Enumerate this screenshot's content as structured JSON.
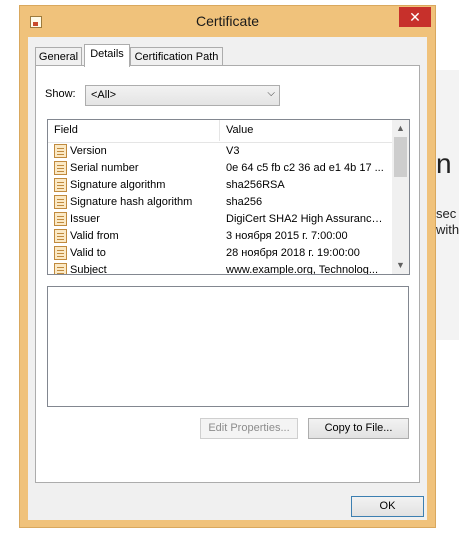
{
  "window": {
    "title": "Certificate",
    "close_glyph": "✕"
  },
  "tabs": [
    {
      "label": "General",
      "active": false
    },
    {
      "label": "Details",
      "active": true
    },
    {
      "label": "Certification Path",
      "active": false
    }
  ],
  "show": {
    "label": "Show:",
    "value": "<All>"
  },
  "fields_table": {
    "columns": [
      "Field",
      "Value"
    ],
    "rows": [
      {
        "field": "Version",
        "value": "V3"
      },
      {
        "field": "Serial number",
        "value": "0e 64 c5 fb c2 36 ad e1 4b 17 ..."
      },
      {
        "field": "Signature algorithm",
        "value": "sha256RSA"
      },
      {
        "field": "Signature hash algorithm",
        "value": "sha256"
      },
      {
        "field": "Issuer",
        "value": "DigiCert SHA2 High Assurance ..."
      },
      {
        "field": "Valid from",
        "value": "3 ноября 2015 г. 7:00:00"
      },
      {
        "field": "Valid to",
        "value": "28 ноября 2018 г. 19:00:00"
      },
      {
        "field": "Subject",
        "value": "www.example.org, Technolog..."
      }
    ]
  },
  "buttons": {
    "edit_properties": "Edit Properties...",
    "copy_to_file": "Copy to File...",
    "ok": "OK"
  },
  "background": {
    "heading_fragment": "n",
    "line1_fragment": "sec",
    "line2_fragment": "with"
  }
}
